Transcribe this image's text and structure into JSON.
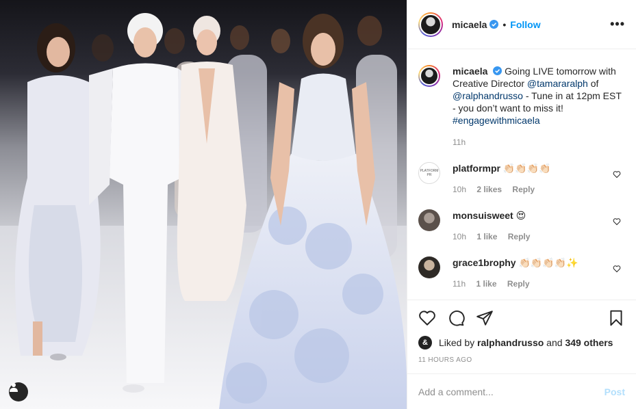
{
  "post": {
    "image_alt": "Runway models in white and pale blue gowns",
    "user_tag_icon": "user-icon"
  },
  "header": {
    "username": "micaela",
    "follow_label": "Follow",
    "separator": "•",
    "more_label": "•••"
  },
  "caption": {
    "username": "micaela",
    "text_1": "Going LIVE tomorrow with Creative Director ",
    "mention_1": "@tamararalph",
    "text_2": " of ",
    "mention_2": "@ralphandrusso",
    "text_3": " - Tune in at 12pm EST - you don’t want to miss it! ",
    "hashtag": "#engagewithmicaela",
    "time": "11h"
  },
  "comments": [
    {
      "username": "platformpr",
      "text": "👏🏻👏🏻👏🏻👏🏻",
      "time": "10h",
      "likes": "2 likes",
      "reply": "Reply",
      "avatar_text": "PLATFORM PR"
    },
    {
      "username": "monsuisweet",
      "text": "😍",
      "time": "10h",
      "likes": "1 like",
      "reply": "Reply"
    },
    {
      "username": "grace1brophy",
      "text": "👏🏻👏🏻👏🏻👏🏻✨",
      "time": "11h",
      "likes": "1 like",
      "reply": "Reply"
    }
  ],
  "likes": {
    "prefix": "Liked by ",
    "user": "ralphandrusso",
    "middle": " and ",
    "others": "349 others"
  },
  "timestamp": "11 HOURS AGO",
  "add_comment": {
    "placeholder": "Add a comment...",
    "post_label": "Post"
  },
  "colors": {
    "accent": "#0095f6",
    "link": "#00376b",
    "muted": "#8e8e8e",
    "post_disabled": "#b2dffc"
  }
}
